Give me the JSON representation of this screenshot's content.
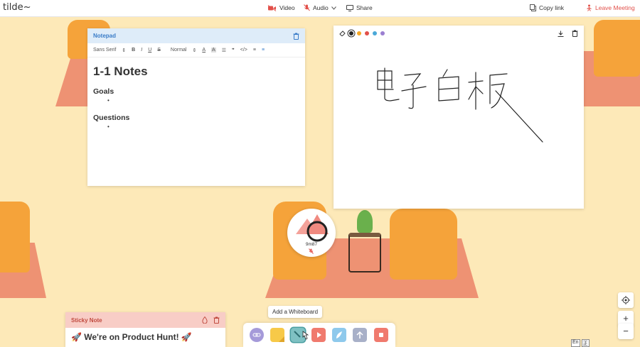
{
  "app": {
    "logo": "tilde~"
  },
  "topbar": {
    "video": "Video",
    "audio": "Audio",
    "share": "Share",
    "copy_link": "Copy link",
    "leave": "Leave Meeting"
  },
  "notepad": {
    "title": "Notepad",
    "font": "Sans Serif",
    "size": "Normal",
    "heading": "1-1 Notes",
    "section1": "Goals",
    "section2": "Questions",
    "bullet": "•"
  },
  "whiteboard": {
    "colors": [
      "#222222",
      "#f5a623",
      "#e2504a",
      "#4aa8d8",
      "#9b7fd1"
    ],
    "handwriting": "电子白板"
  },
  "participant": {
    "name": "9m87"
  },
  "sticky": {
    "title": "Sticky Note",
    "text": "🚀 We're on Product Hunt! 🚀"
  },
  "dock": {
    "tooltip": "Add a Whiteboard"
  },
  "zoom": {
    "in": "+",
    "out": "−"
  },
  "tray": [
    "En",
    "正"
  ]
}
